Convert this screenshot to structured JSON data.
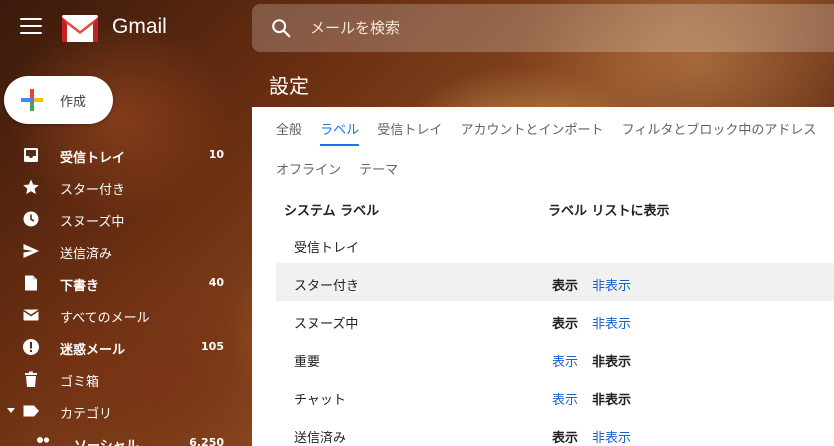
{
  "header": {
    "app_name": "Gmail",
    "search_placeholder": "メールを検索"
  },
  "sidebar": {
    "compose_label": "作成",
    "items": [
      {
        "label": "受信トレイ",
        "count": "10"
      },
      {
        "label": "スター付き",
        "count": ""
      },
      {
        "label": "スヌーズ中",
        "count": ""
      },
      {
        "label": "送信済み",
        "count": ""
      },
      {
        "label": "下書き",
        "count": "40"
      },
      {
        "label": "すべてのメール",
        "count": ""
      },
      {
        "label": "迷惑メール",
        "count": "105"
      },
      {
        "label": "ゴミ箱",
        "count": ""
      },
      {
        "label": "カテゴリ",
        "count": ""
      },
      {
        "label": "ソーシャル",
        "count": "6,250"
      }
    ]
  },
  "settings": {
    "title": "設定",
    "tabs_row1": [
      "全般",
      "ラベル",
      "受信トレイ",
      "アカウントとインポート",
      "フィルタとブロック中のアドレス"
    ],
    "tabs_row2": [
      "オフライン",
      "テーマ"
    ],
    "active_tab": "ラベル",
    "table": {
      "headers": [
        "システム ラベル",
        "ラベル リストに表示"
      ],
      "rows": [
        {
          "name": "受信トレイ",
          "show": "",
          "hide": "",
          "selected": ""
        },
        {
          "name": "スター付き",
          "show": "表示",
          "hide": "非表示",
          "selected": "show"
        },
        {
          "name": "スヌーズ中",
          "show": "表示",
          "hide": "非表示",
          "selected": "show"
        },
        {
          "name": "重要",
          "show": "表示",
          "hide": "非表示",
          "selected": "hide"
        },
        {
          "name": "チャット",
          "show": "表示",
          "hide": "非表示",
          "selected": "hide"
        },
        {
          "name": "送信済み",
          "show": "表示",
          "hide": "非表示",
          "selected": "show"
        }
      ]
    }
  },
  "colors": {
    "accent": "#1a73e8",
    "link": "#1a5fd1",
    "logo_red": "#ea4335"
  }
}
